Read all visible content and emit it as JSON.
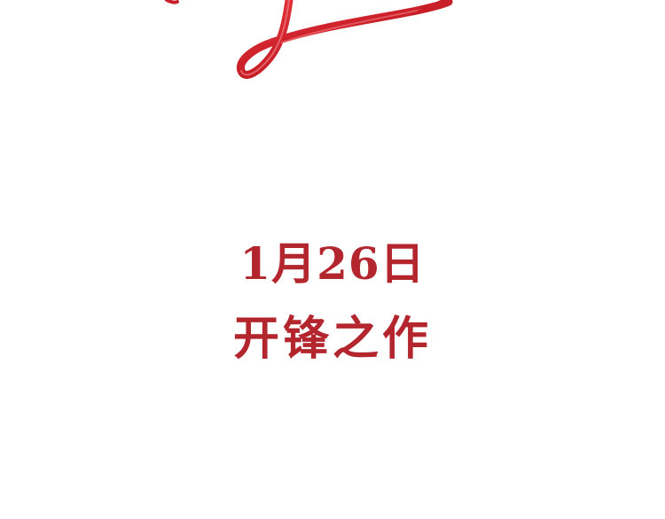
{
  "colors": {
    "text": "#b3262e",
    "ribbon": "#c81f28",
    "background": "#ffffff"
  },
  "headline": {
    "date": "1月26日",
    "subtitle": "开锋之作"
  },
  "decoration": {
    "icon": "red-ribbon-calligraphy-icon"
  }
}
